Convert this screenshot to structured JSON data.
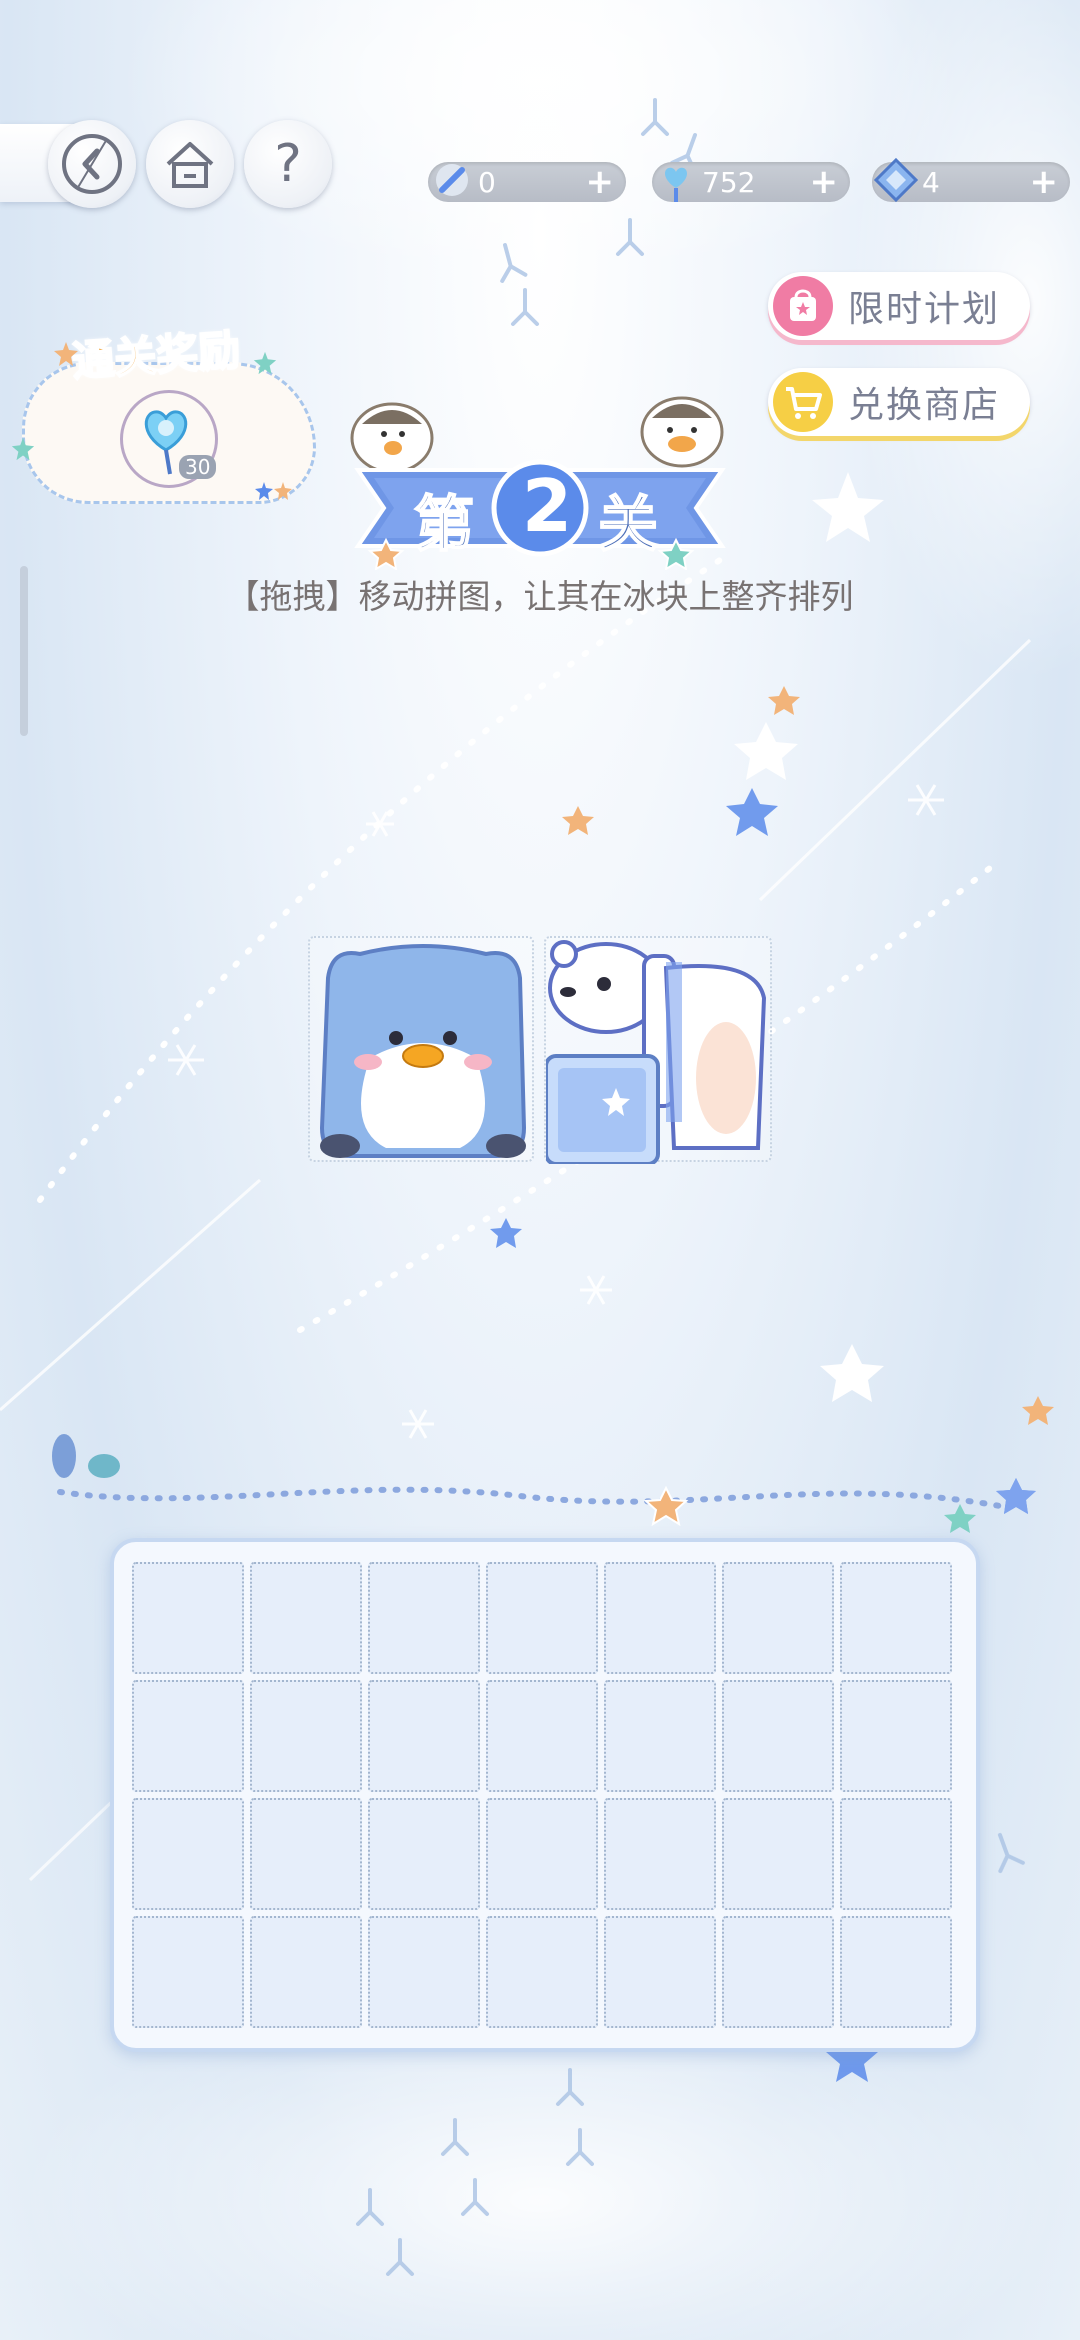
{
  "topbar": {
    "currencies": [
      {
        "icon": "shovel-icon",
        "value": "0",
        "plus": "+"
      },
      {
        "icon": "heart-wand-icon",
        "value": "752",
        "plus": "+"
      },
      {
        "icon": "diamond-icon",
        "value": "4",
        "plus": "+"
      }
    ],
    "help_label": "?"
  },
  "right_buttons": {
    "limited_plan": "限时计划",
    "exchange_shop": "兑换商店"
  },
  "reward": {
    "title": "通关奖励",
    "count": "30",
    "icon": "heart-lollipop-icon"
  },
  "stage": {
    "prefix": "第",
    "number": "2",
    "suffix": "关",
    "hint": "【拖拽】移动拼图，让其在冰块上整齐排列"
  },
  "puzzle": {
    "pieces": [
      "penguin-piece",
      "polar-bear-piece",
      "ice-cube-piece"
    ]
  },
  "board": {
    "rows": 4,
    "cols": 7
  },
  "colors": {
    "accent_blue": "#5b8bea",
    "pink": "#f07ca4",
    "yellow": "#f6cf45"
  }
}
